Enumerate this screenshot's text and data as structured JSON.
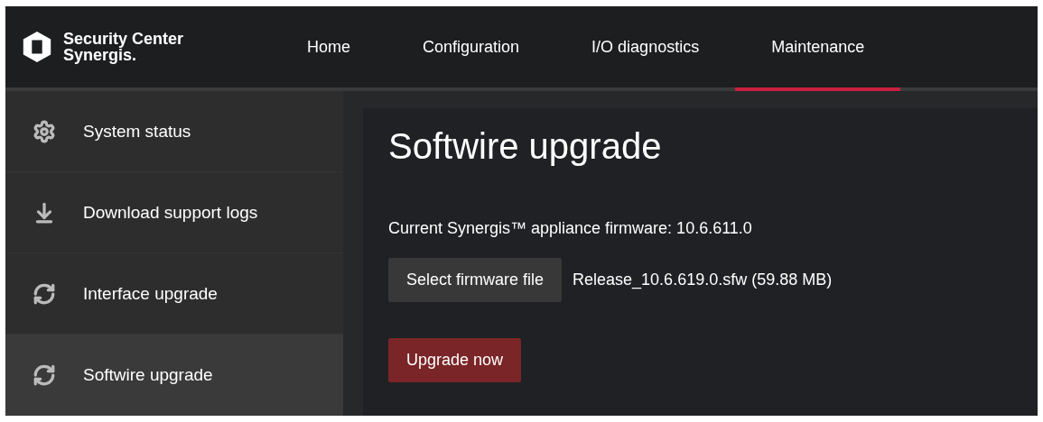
{
  "header": {
    "logo": {
      "line_1": "Security Center",
      "line_2": "Synergis."
    },
    "tabs": [
      {
        "label": "Home",
        "selected": false
      },
      {
        "label": "Configuration",
        "selected": false
      },
      {
        "label": "I/O diagnostics",
        "selected": false
      },
      {
        "label": "Maintenance",
        "selected": true
      }
    ]
  },
  "sidebar": {
    "items": [
      {
        "label": "System status",
        "kind": "status",
        "selected": false
      },
      {
        "label": "Download support logs",
        "kind": "download",
        "selected": false
      },
      {
        "label": "Interface upgrade",
        "kind": "upgrade",
        "selected": false
      },
      {
        "label": "Softwire upgrade",
        "kind": "upgrade",
        "selected": true
      }
    ]
  },
  "content": {
    "title": "Softwire upgrade",
    "firmware_text": "Current Synergis™ appliance firmware: 10.6.611.0",
    "select_button": "Select firmware file",
    "selected_file": "Release_10.6.619.0.sfw (59.88 MB)",
    "upgrade_button": "Upgrade now"
  }
}
